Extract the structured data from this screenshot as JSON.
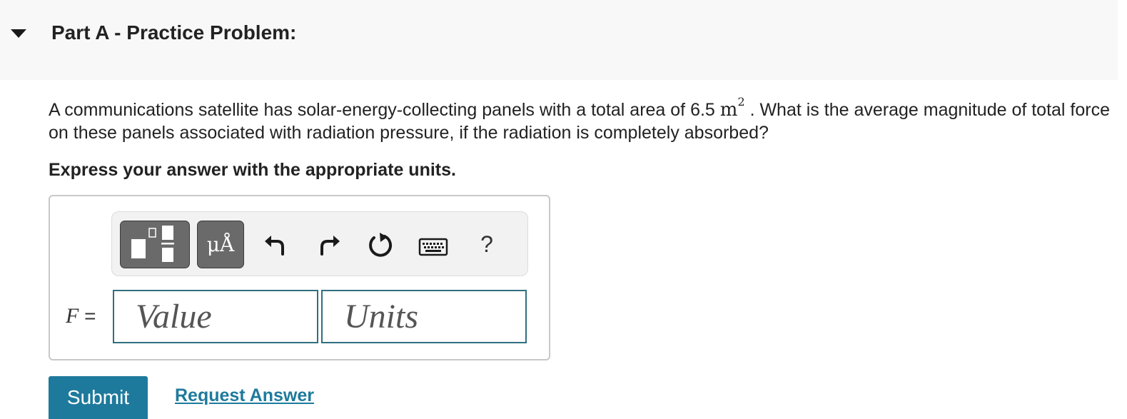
{
  "part": {
    "title": "Part A - Practice Problem:",
    "toggle_icon": "caret-down-icon"
  },
  "question": {
    "text_before": "A communications satellite has solar-energy-collecting panels with a total area of 6.5 ",
    "unit": "m",
    "unit_exponent": "2",
    "text_after": " . What is the average magnitude of total force on these panels associated with radiation pressure, if the radiation is completely absorbed?"
  },
  "instruction": "Express your answer with the appropriate units.",
  "toolbar": {
    "templates_icon": "templates-icon",
    "units_label": "μÅ",
    "undo_icon": "undo-icon",
    "redo_icon": "redo-icon",
    "reset_icon": "reset-icon",
    "keyboard_icon": "keyboard-icon",
    "help_label": "?"
  },
  "answer": {
    "variable": "F",
    "equals": "=",
    "value_placeholder": "Value",
    "units_placeholder": "Units",
    "field_border_color": "#2f6f7f"
  },
  "actions": {
    "submit_label": "Submit",
    "request_label": "Request Answer",
    "accent_color": "#1e7a9c"
  }
}
